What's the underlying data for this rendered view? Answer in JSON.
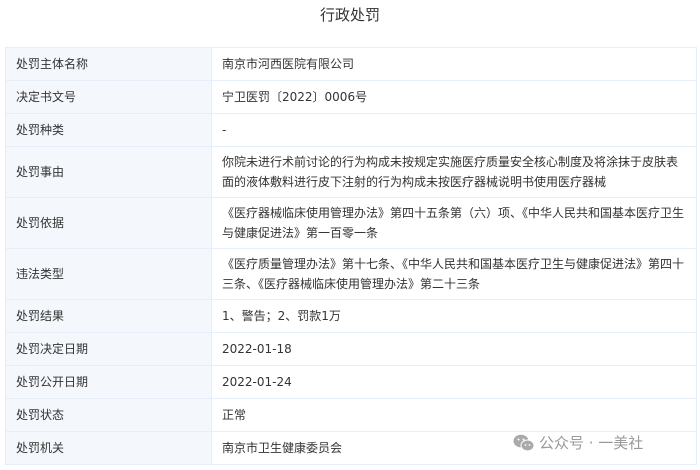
{
  "title": "行政处罚",
  "rows": [
    {
      "label": "处罚主体名称",
      "value": "南京市河西医院有限公司"
    },
    {
      "label": "决定书文号",
      "value": "宁卫医罚〔2022〕0006号"
    },
    {
      "label": "处罚种类",
      "value": "-"
    },
    {
      "label": "处罚事由",
      "value": "你院未进行术前讨论的行为构成未按规定实施医疗质量安全核心制度及将涂抹于皮肤表面的液体敷料进行皮下注射的行为构成未按医疗器械说明书使用医疗器械"
    },
    {
      "label": "处罚依据",
      "value": "《医疗器械临床使用管理办法》第四十五条第（六）项、《中华人民共和国基本医疗卫生与健康促进法》第一百零一条"
    },
    {
      "label": "违法类型",
      "value": "《医疗质量管理办法》第十七条、《中华人民共和国基本医疗卫生与健康促进法》第四十三条、《医疗器械临床使用管理办法》第二十三条"
    },
    {
      "label": "处罚结果",
      "value": "1、警告；2、罚款1万"
    },
    {
      "label": "处罚决定日期",
      "value": "2022-01-18"
    },
    {
      "label": "处罚公开日期",
      "value": "2022-01-24"
    },
    {
      "label": "处罚状态",
      "value": "正常"
    },
    {
      "label": "处罚机关",
      "value": "南京市卫生健康委员会"
    }
  ],
  "watermark": "公众号 · 一美社"
}
